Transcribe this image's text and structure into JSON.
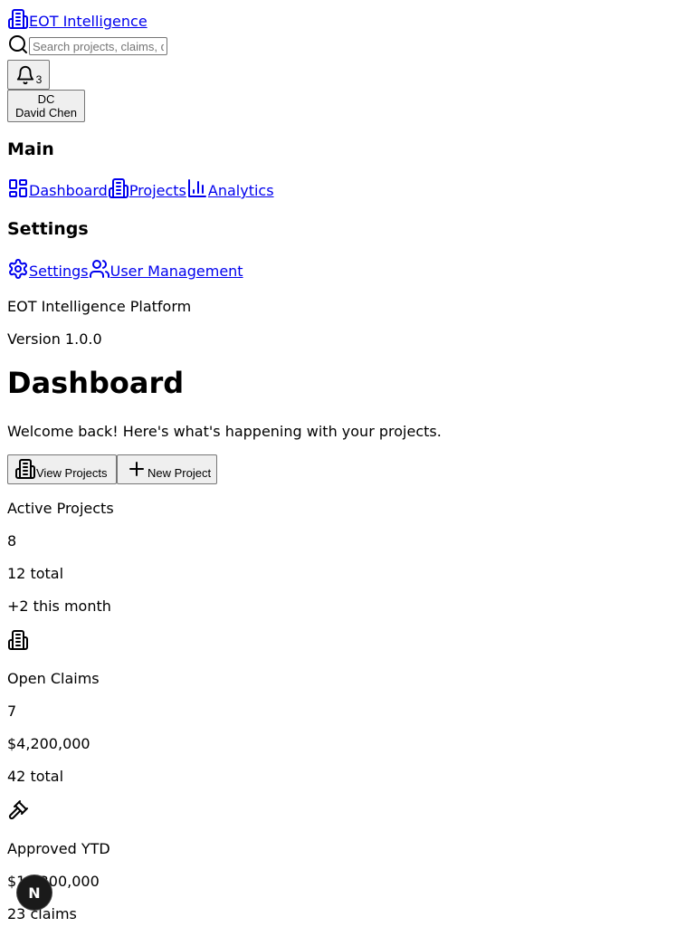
{
  "header": {
    "brand": "EOT Intelligence",
    "search_placeholder": "Search projects, claims, documents...",
    "notifications_count": "3",
    "user_initials": "DC",
    "user_name": "David Chen"
  },
  "sidebar": {
    "main_heading": "Main",
    "main_items": [
      {
        "label": "Dashboard",
        "icon": "dashboard-icon"
      },
      {
        "label": "Projects",
        "icon": "building-icon"
      },
      {
        "label": "Analytics",
        "icon": "bar-chart-icon"
      }
    ],
    "settings_heading": "Settings",
    "settings_items": [
      {
        "label": "Settings",
        "icon": "gear-icon"
      },
      {
        "label": "User Management",
        "icon": "users-icon"
      }
    ],
    "footer_name": "EOT Intelligence Platform",
    "footer_version": "Version 1.0.0"
  },
  "main": {
    "title": "Dashboard",
    "subtitle": "Welcome back! Here's what's happening with your projects.",
    "view_projects_label": "View Projects",
    "new_project_label": "New Project"
  },
  "stats": [
    {
      "label": "Active Projects",
      "value": "8",
      "sub1": "12 total",
      "sub2": "+2 this month",
      "icon": "building-icon"
    },
    {
      "label": "Open Claims",
      "value": "7",
      "sub1": "$4,200,000",
      "sub2": "42 total",
      "icon": "gavel-icon"
    },
    {
      "label": "Approved YTD",
      "value": "$12,300,000",
      "sub1": "23 claims"
    }
  ],
  "dev_badge": "N"
}
